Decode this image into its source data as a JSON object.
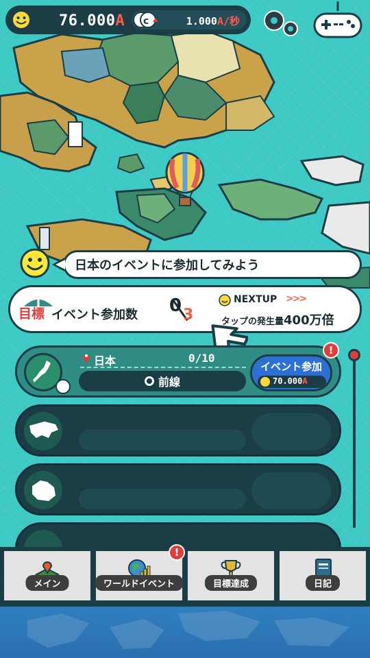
{
  "hud": {
    "money_value": "76.000",
    "money_unit": "A",
    "rate_value": "1.000",
    "rate_unit": "A/秒"
  },
  "speech": {
    "text": "日本のイベントに参加してみよう"
  },
  "goal": {
    "target_label": "目標",
    "name": "イベント参加数",
    "current": "0",
    "total": "3",
    "next_label": "NEXTUP",
    "next_arrows": ">>>",
    "next_desc_prefix": "タップの発生量",
    "next_desc_value": "400万倍"
  },
  "regions": [
    {
      "name": "日本",
      "progress": "0/10",
      "line_name": "前線",
      "event_button_label": "イベント参加",
      "event_cost_value": "70.000",
      "event_cost_unit": "A",
      "alert": "!"
    }
  ],
  "nav": {
    "items": [
      {
        "label": "メイン",
        "icon": "map-pin-icon"
      },
      {
        "label": "ワールドイベント",
        "icon": "globe-chart-icon",
        "alert": "!"
      },
      {
        "label": "目標達成",
        "icon": "trophy-icon"
      },
      {
        "label": "日記",
        "icon": "diary-icon"
      }
    ]
  },
  "colors": {
    "sea": "#3fc9c5",
    "dark": "#1a3d46",
    "accent_red": "#e23d3d",
    "button_blue": "#2e6fd6"
  }
}
